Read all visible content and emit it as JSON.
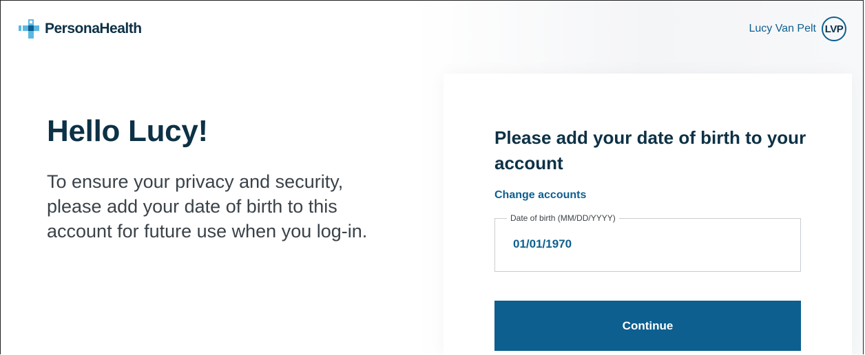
{
  "header": {
    "brand_name": "PersonaHealth",
    "brand_icon": "plus-cross-logo-icon",
    "user_name": "Lucy Van Pelt",
    "user_initials": "LVP"
  },
  "greeting": {
    "title": "Hello Lucy!",
    "body": "To ensure your privacy and security, please add your date of birth to this account for future use when you log-in."
  },
  "card": {
    "title": "Please add your date of birth to your account",
    "change_accounts_label": "Change accounts",
    "dob_label": "Date of birth (MM/DD/YYYY)",
    "dob_value": "01/01/1970",
    "continue_label": "Continue"
  },
  "colors": {
    "primary": "#0d5f8f",
    "heading": "#0d3146",
    "logo_light": "#5bb8e3",
    "logo_dark": "#0d5f8f"
  }
}
